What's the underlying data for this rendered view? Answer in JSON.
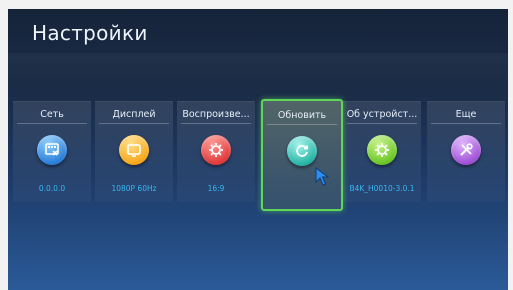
{
  "screen": {
    "title": "Настройки"
  },
  "tiles": [
    {
      "label": "Сеть",
      "value": "0.0.0.0",
      "icon": "network-icon"
    },
    {
      "label": "Дисплей",
      "value": "1080P 60Hz",
      "icon": "display-icon"
    },
    {
      "label": "Воспроизве...",
      "value": "16:9",
      "icon": "playback-gear-icon"
    },
    {
      "label": "Обновить",
      "value": "",
      "icon": "refresh-icon",
      "selected": true
    },
    {
      "label": "Об устройст...",
      "value": "B4K_H0010-3.0.1",
      "icon": "device-gear-icon"
    },
    {
      "label": "Еще",
      "value": "",
      "icon": "tools-icon"
    }
  ],
  "colors": {
    "accent_value": "#38b7f0",
    "selection_border": "#5fd65a",
    "background_top": "#16243a",
    "background_bottom": "#2a5a98"
  }
}
